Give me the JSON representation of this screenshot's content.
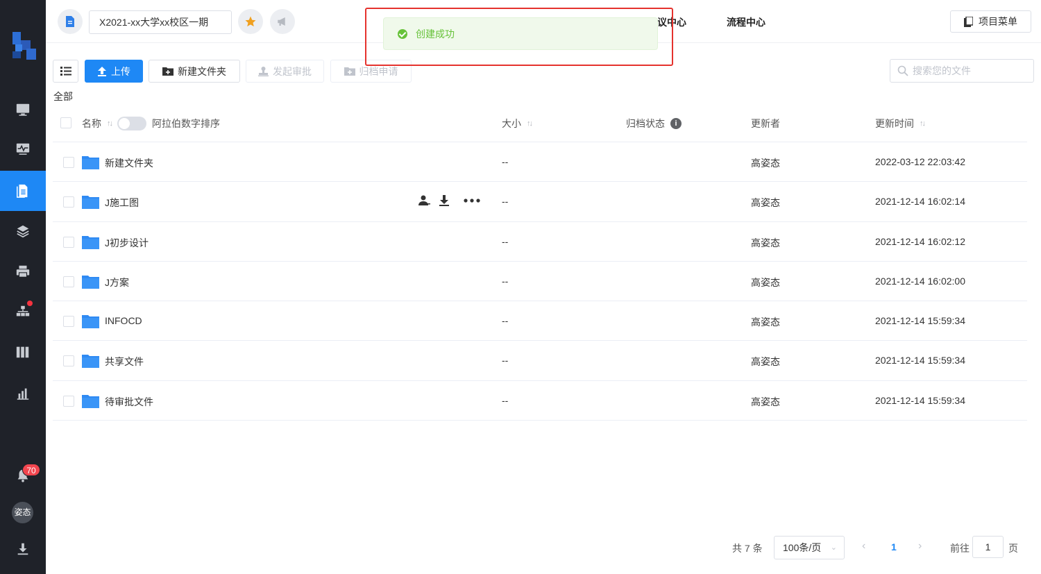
{
  "header": {
    "project_name": "X2021-xx大学xx校区一期",
    "link_partial": "议中心",
    "link_flow": "流程中心",
    "menu_label": "项目菜单"
  },
  "toolbar": {
    "upload": "上传",
    "new_folder": "新建文件夹",
    "approve": "发起审批",
    "archive": "归档申请",
    "search_placeholder": "搜索您的文件"
  },
  "breadcrumb": "全部",
  "table": {
    "headers": {
      "name": "名称",
      "arabic_sort": "阿拉伯数字排序",
      "size": "大小",
      "archive_status": "归档状态",
      "updater": "更新者",
      "updated_at": "更新时间"
    },
    "rows": [
      {
        "name": "新建文件夹",
        "size": "--",
        "updater": "高姿态",
        "time": "2022-03-12 22:03:42"
      },
      {
        "name": "J施工图",
        "size": "--",
        "updater": "高姿态",
        "time": "2021-12-14 16:02:14"
      },
      {
        "name": "J初步设计",
        "size": "--",
        "updater": "高姿态",
        "time": "2021-12-14 16:02:12"
      },
      {
        "name": "J方案",
        "size": "--",
        "updater": "高姿态",
        "time": "2021-12-14 16:02:00"
      },
      {
        "name": "INFOCD",
        "size": "--",
        "updater": "高姿态",
        "time": "2021-12-14 15:59:34"
      },
      {
        "name": "共享文件",
        "size": "--",
        "updater": "高姿态",
        "time": "2021-12-14 15:59:34"
      },
      {
        "name": "待审批文件",
        "size": "--",
        "updater": "高姿态",
        "time": "2021-12-14 15:59:34"
      }
    ]
  },
  "pagination": {
    "total": "共 7 条",
    "page_size": "100条/页",
    "current": "1",
    "goto_label": "前往",
    "goto_value": "1",
    "page_suffix": "页"
  },
  "sidebar": {
    "notification_count": "70",
    "avatar_text": "姿态"
  },
  "toast": {
    "message": "创建成功"
  },
  "colors": {
    "primary": "#1e88f5",
    "sidebar_bg": "#1f2229",
    "success": "#67c23a",
    "highlight": "#e5322d"
  }
}
